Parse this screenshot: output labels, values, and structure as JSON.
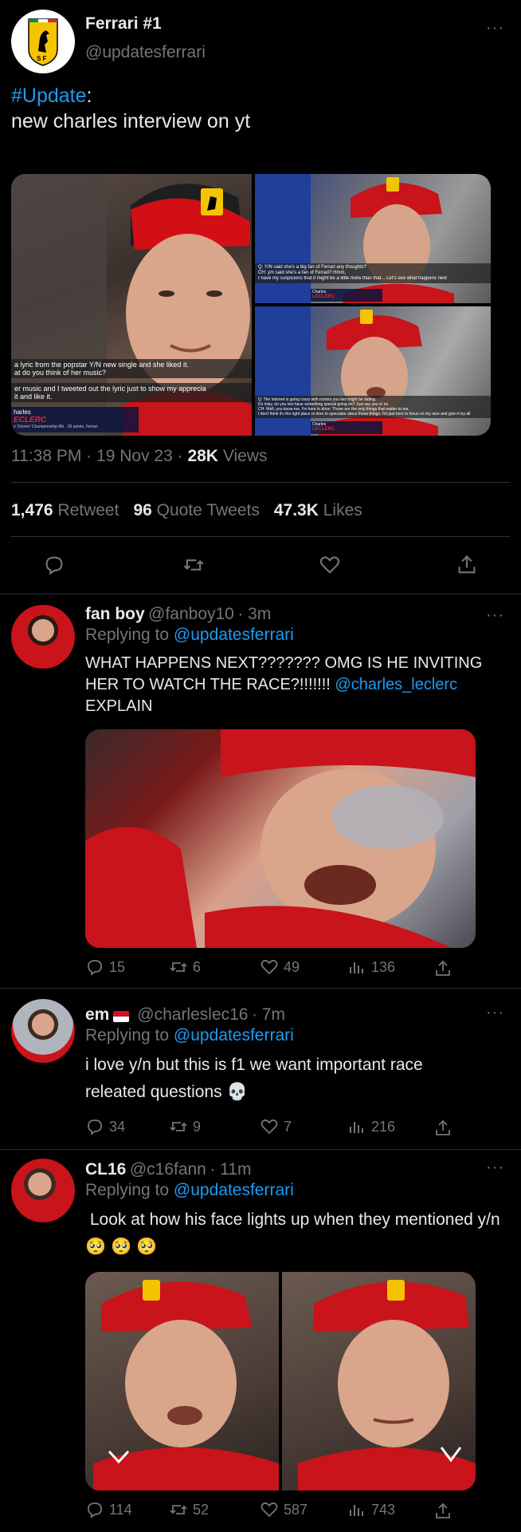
{
  "main_tweet": {
    "display_name": "Ferrari #1",
    "handle": "@updatesferrari",
    "hashtag": "#Update",
    "colon": ":",
    "text": "new charles interview on yt",
    "image_captions": {
      "left_line1": "a lyric from the popstar Y/N new single and she liked it.",
      "left_line2": "at do you think of her music?",
      "left_line3": "er music and I tweeted out the lyric just to show my apprecia",
      "left_line4": "it and like it.",
      "left_name": "harles",
      "left_surname": "ECLERC",
      "left_sub": "s' Drivers' Championship 6th · 26 points, Ferrari",
      "topright_q": "Q: Y/N said she's a big fan of Ferrari any thoughts?",
      "topright_a1": "CH: y/n said she's a fan of Ferrari? Hmm,",
      "topright_a2": "I have my suspicions that it might be a little more than that... Let's see what happens next",
      "topright_name": "Charles",
      "topright_surname": "LECLERC",
      "bottomright_q1": "Q: The internet is going crazy with rumors you two might be dating.",
      "bottomright_q2": "It's risky, do you two have something special going on? Just say yes or no",
      "bottomright_a1": "CH: Well, you know me, I'm here to drive. Those are the only things that matter to me.",
      "bottomright_a2": "I don't think it's the right place or time to speculate about these things. I'm just here to focus on my race and give it my all",
      "bottomright_name": "Charles",
      "bottomright_surname": "LECLERC"
    },
    "time": "11:38 PM",
    "date": "19 Nov 23",
    "sep": "·",
    "views_count": "28K",
    "views_label": "Views",
    "retweets_count": "1,476",
    "retweets_label": "Retweet",
    "quotes_count": "96",
    "quotes_label": "Quote Tweets",
    "likes_count": "47.3K",
    "likes_label": "Likes"
  },
  "replies": [
    {
      "display_name": "fan boy",
      "handle": "@fanboy10",
      "time": "· 3m",
      "replying_label": "Replying to",
      "replying_to": "@updatesferrari",
      "text": "WHAT HAPPENS NEXT??????? OMG IS HE INVITING HER TO WATCH THE RACE?!!!!!!!",
      "mention": "@charles_leclerc",
      "text_end": "EXPLAIN",
      "replies": "15",
      "retweets": "6",
      "likes": "49",
      "views": "136"
    },
    {
      "display_name": "em",
      "handle": "@charleslec16",
      "time": "· 7m",
      "replying_label": "Replying to",
      "replying_to": "@updatesferrari",
      "text": "i love y/n but this is f1 we want important race releated questions 💀",
      "replies": "34",
      "retweets": "9",
      "likes": "7",
      "views": "216"
    },
    {
      "display_name": "CL16",
      "handle": "@c16fann",
      "time": "· 11m",
      "replying_label": "Replying to",
      "replying_to": "@updatesferrari",
      "text": " Look at how his face lights up when they mentioned y/n 🥺 🥺 🥺",
      "replies": "114",
      "retweets": "52",
      "likes": "587",
      "views": "743"
    }
  ],
  "icons": {
    "more": "more-dots-icon",
    "reply": "reply-icon",
    "retweet": "retweet-icon",
    "like": "heart-icon",
    "views": "views-icon",
    "share": "share-icon"
  },
  "colors": {
    "background": "#000000",
    "text": "#e7e9ea",
    "muted": "#71767b",
    "link": "#1d9bf0",
    "divider": "#2f3336",
    "ferrari_red": "#d40000",
    "ferrari_yellow": "#f5c400"
  }
}
